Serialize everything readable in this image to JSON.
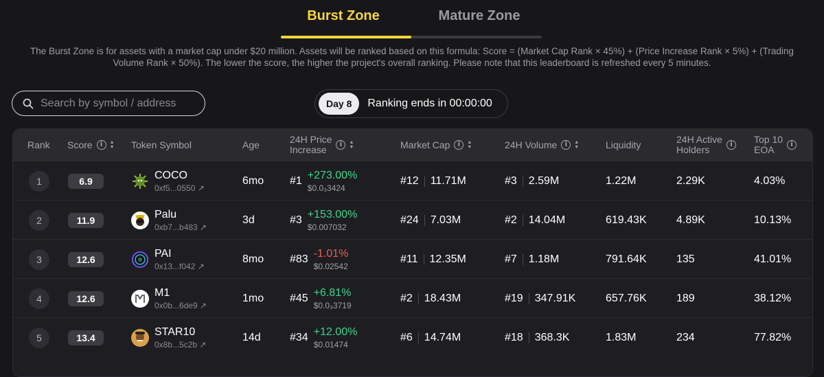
{
  "tabs": {
    "burst": "Burst Zone",
    "mature": "Mature Zone"
  },
  "description": "The Burst Zone is for assets with a market cap under $20 million. Assets will be ranked based on this formula: Score = (Market Cap Rank × 45%) + (Price Increase Rank × 5%) + (Trading Volume Rank × 50%). The lower the score, the higher the project's overall ranking. Please note that this leaderboard is refreshed every 5 minutes.",
  "search": {
    "placeholder": "Search by symbol / address"
  },
  "timer": {
    "day": "Day 8",
    "text": "Ranking ends in 00:00:00"
  },
  "colors": {
    "accent": "#f5d53b",
    "up": "#3dd68c",
    "down": "#f25a5a"
  },
  "headers": {
    "rank": "Rank",
    "score": "Score",
    "token": "Token Symbol",
    "age": "Age",
    "price_l1": "24H Price",
    "price_l2": "Increase",
    "mcap": "Market Cap",
    "volume": "24H Volume",
    "liquidity": "Liquidity",
    "holders_l1": "24H Active",
    "holders_l2": "Holders",
    "eoa_l1": "Top 10",
    "eoa_l2": "EOA"
  },
  "rows": [
    {
      "rank": "1",
      "score": "6.9",
      "symbol": "COCO",
      "address": "0xf5...0550 ↗",
      "icon": "coco-virus-icon",
      "age": "6mo",
      "price_rank": "#1",
      "change": "+273.00%",
      "direction": "up",
      "price": "$0.0₃3424",
      "mcap_rank": "#12",
      "mcap": "11.71M",
      "vol_rank": "#3",
      "volume": "2.59M",
      "liquidity": "1.22M",
      "holders": "2.29K",
      "eoa": "4.03%"
    },
    {
      "rank": "2",
      "score": "11.9",
      "symbol": "Palu",
      "address": "0xb7...b483 ↗",
      "icon": "palu-avatar-icon",
      "age": "3d",
      "price_rank": "#3",
      "change": "+153.00%",
      "direction": "up",
      "price": "$0.007032",
      "mcap_rank": "#24",
      "mcap": "7.03M",
      "vol_rank": "#2",
      "volume": "14.04M",
      "liquidity": "619.43K",
      "holders": "4.89K",
      "eoa": "10.13%"
    },
    {
      "rank": "3",
      "score": "12.6",
      "symbol": "PAI",
      "address": "0x13...f042 ↗",
      "icon": "pai-ring-icon",
      "age": "8mo",
      "price_rank": "#83",
      "change": "-1.01%",
      "direction": "down",
      "price": "$0.02542",
      "mcap_rank": "#11",
      "mcap": "12.35M",
      "vol_rank": "#7",
      "volume": "1.18M",
      "liquidity": "791.64K",
      "holders": "135",
      "eoa": "41.01%"
    },
    {
      "rank": "4",
      "score": "12.6",
      "symbol": "M1",
      "address": "0x0b...6de9 ↗",
      "icon": "m1-logo-icon",
      "age": "1mo",
      "price_rank": "#45",
      "change": "+6.81%",
      "direction": "up",
      "price": "$0.0₃3719",
      "mcap_rank": "#2",
      "mcap": "18.43M",
      "vol_rank": "#19",
      "volume": "347.91K",
      "liquidity": "657.76K",
      "holders": "189",
      "eoa": "38.12%"
    },
    {
      "rank": "5",
      "score": "13.4",
      "symbol": "STAR10",
      "address": "0x8b...5c2b ↗",
      "icon": "star10-avatar-icon",
      "age": "14d",
      "price_rank": "#34",
      "change": "+12.00%",
      "direction": "up",
      "price": "$0.01474",
      "mcap_rank": "#6",
      "mcap": "14.74M",
      "vol_rank": "#18",
      "volume": "368.3K",
      "liquidity": "1.83M",
      "holders": "234",
      "eoa": "77.82%"
    }
  ]
}
